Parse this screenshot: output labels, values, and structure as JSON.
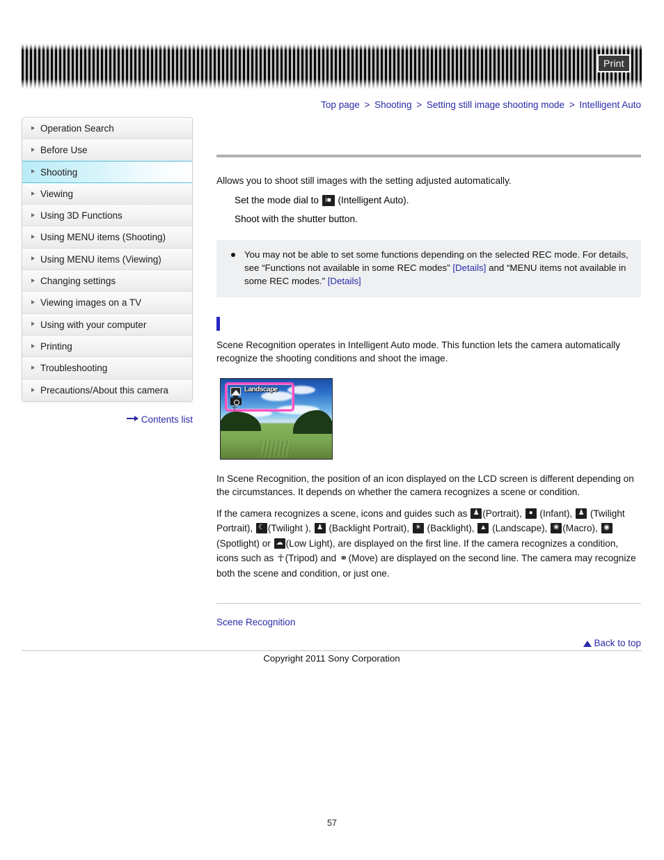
{
  "header": {
    "print_label": "Print",
    "print_icon": "print-icon"
  },
  "breadcrumb": {
    "separator": ">",
    "items": [
      {
        "label": "Top page"
      },
      {
        "label": "Shooting"
      },
      {
        "label": "Setting still image shooting mode"
      },
      {
        "label": "Intelligent Auto"
      }
    ]
  },
  "sidebar": {
    "items": [
      {
        "label": "Operation Search",
        "active": false
      },
      {
        "label": "Before Use",
        "active": false
      },
      {
        "label": "Shooting",
        "active": true
      },
      {
        "label": "Viewing",
        "active": false
      },
      {
        "label": "Using 3D Functions",
        "active": false
      },
      {
        "label": "Using MENU items (Shooting)",
        "active": false
      },
      {
        "label": "Using MENU items (Viewing)",
        "active": false
      },
      {
        "label": "Changing settings",
        "active": false
      },
      {
        "label": "Viewing images on a TV",
        "active": false
      },
      {
        "label": "Using with your computer",
        "active": false
      },
      {
        "label": "Printing",
        "active": false
      },
      {
        "label": "Troubleshooting",
        "active": false
      },
      {
        "label": "Precautions/About this camera",
        "active": false
      }
    ],
    "contents_list_label": "Contents list",
    "contents_list_icon": "arrow-right-icon"
  },
  "main": {
    "page_title": "",
    "intro": "Allows you to shoot still images with the setting adjusted automatically.",
    "steps": {
      "step1_before": "Set the mode dial to ",
      "step1_icon": "intelligent-auto-mode-icon",
      "step1_after": " (Intelligent Auto).",
      "step2": "Shoot with the shutter button."
    },
    "note": {
      "text_1": "You may not be able to set some functions depending on the selected REC mode. For details, see “Functions not available in some REC modes” ",
      "link_1": "[Details]",
      "text_2": " and “MENU items not available in some REC modes.” ",
      "link_2": "[Details]"
    },
    "section": {
      "heading": "",
      "paragraph": "Scene Recognition operates in Intelligent Auto mode. This function lets the camera automatically recognize the shooting conditions and shoot the image."
    },
    "figure": {
      "name": "lcd-scene-recognition-example",
      "osd_scene_label": "Landscape",
      "osd_scene_icon": "landscape-icon",
      "osd_camera_icon": "camera-icon",
      "osd_tripod_icon": "tripod-icon",
      "highlight_color": "#ff4fc0"
    },
    "explain": {
      "p1": "In Scene Recognition, the position of an icon displayed on the LCD screen is different depending on the circumstances. It depends on whether the camera recognizes a scene or condition.",
      "p2_parts": [
        {
          "type": "text",
          "value": "If the camera recognizes a scene, icons and guides such as "
        },
        {
          "type": "icon",
          "name": "portrait-icon",
          "glyph": "♟"
        },
        {
          "type": "text",
          "value": "(Portrait), "
        },
        {
          "type": "icon",
          "name": "infant-icon",
          "glyph": "◕"
        },
        {
          "type": "text",
          "value": " (Infant), "
        },
        {
          "type": "icon",
          "name": "twilight-portrait-icon",
          "glyph": "☽"
        },
        {
          "type": "text",
          "value": " (Twilight Portrait), "
        },
        {
          "type": "icon",
          "name": "twilight-icon",
          "glyph": "☾"
        },
        {
          "type": "text",
          "value": "(Twilight ), "
        },
        {
          "type": "icon",
          "name": "backlight-portrait-icon",
          "glyph": "☼"
        },
        {
          "type": "text",
          "value": " (Backlight Portrait), "
        },
        {
          "type": "icon",
          "name": "backlight-icon",
          "glyph": "☀"
        },
        {
          "type": "text",
          "value": " (Backlight), "
        },
        {
          "type": "icon",
          "name": "landscape-icon",
          "glyph": "▲"
        },
        {
          "type": "text",
          "value": " (Landscape), "
        },
        {
          "type": "icon",
          "name": "macro-icon",
          "glyph": "❀"
        },
        {
          "type": "text",
          "value": "(Macro), "
        },
        {
          "type": "icon",
          "name": "spotlight-icon",
          "glyph": "◉"
        },
        {
          "type": "text",
          "value": "(Spotlight) or "
        },
        {
          "type": "icon",
          "name": "low-light-icon",
          "glyph": "♑"
        },
        {
          "type": "text",
          "value": "(Low Light), are displayed on the first line. If the camera recognizes a condition, icons such as "
        },
        {
          "type": "icon",
          "name": "tripod-icon",
          "glyph": "☸"
        },
        {
          "type": "text",
          "value": "(Tripod) and "
        },
        {
          "type": "icon",
          "name": "move-icon",
          "glyph": "↯"
        },
        {
          "type": "text",
          "value": "(Move) are displayed on the second line. The camera may recognize both the scene and condition, or just one."
        }
      ]
    },
    "scene_link_label": "Scene Recognition",
    "back_to_top_label": "Back to top",
    "back_to_top_icon": "triangle-up-icon"
  },
  "footer": {
    "copyright": "Copyright 2011 Sony Corporation",
    "page_number": "57"
  }
}
